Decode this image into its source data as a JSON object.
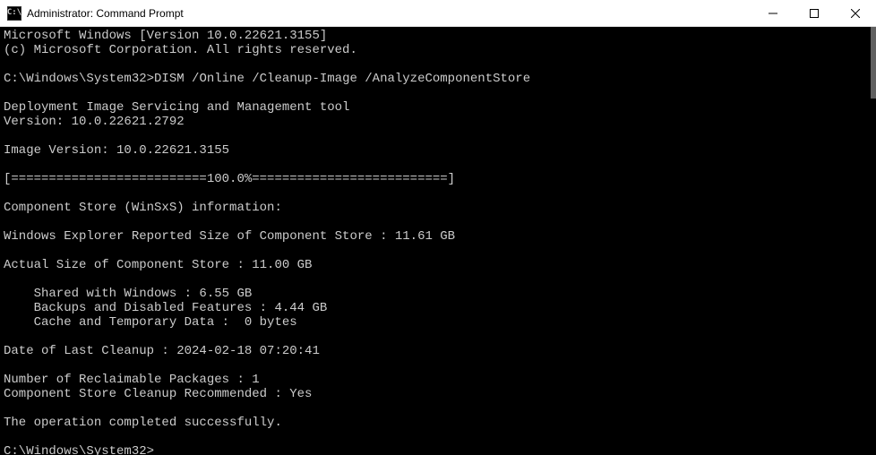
{
  "titlebar": {
    "icon_text": "C:\\",
    "title": "Administrator: Command Prompt"
  },
  "terminal": {
    "line1": "Microsoft Windows [Version 10.0.22621.3155]",
    "line2": "(c) Microsoft Corporation. All rights reserved.",
    "blank1": "",
    "prompt1_path": "C:\\Windows\\System32>",
    "prompt1_cmd": "DISM /Online /Cleanup-Image /AnalyzeComponentStore",
    "blank2": "",
    "line3": "Deployment Image Servicing and Management tool",
    "line4": "Version: 10.0.22621.2792",
    "blank3": "",
    "line5": "Image Version: 10.0.22621.3155",
    "blank4": "",
    "line6": "[==========================100.0%==========================]",
    "blank5": "",
    "line7": "Component Store (WinSxS) information:",
    "blank6": "",
    "line8": "Windows Explorer Reported Size of Component Store : 11.61 GB",
    "blank7": "",
    "line9": "Actual Size of Component Store : 11.00 GB",
    "blank8": "",
    "line10": "    Shared with Windows : 6.55 GB",
    "line11": "    Backups and Disabled Features : 4.44 GB",
    "line12": "    Cache and Temporary Data :  0 bytes",
    "blank9": "",
    "line13": "Date of Last Cleanup : 2024-02-18 07:20:41",
    "blank10": "",
    "line14": "Number of Reclaimable Packages : 1",
    "line15": "Component Store Cleanup Recommended : Yes",
    "blank11": "",
    "line16": "The operation completed successfully.",
    "blank12": "",
    "prompt2_path": "C:\\Windows\\System32>"
  }
}
